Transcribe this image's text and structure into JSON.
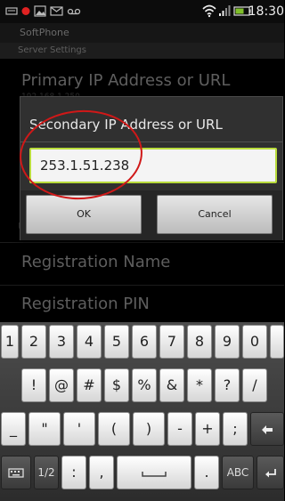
{
  "status": {
    "time": "18:30",
    "icons": [
      "keyboard-notification-icon",
      "red-dot-notification-icon",
      "image-notification-icon",
      "mail-notification-icon",
      "voicemail-notification-icon",
      "wifi-icon",
      "signal-icon",
      "battery-icon"
    ]
  },
  "app": {
    "title": "SoftPhone",
    "section": "Server Settings"
  },
  "settings": {
    "primary_label": "Primary IP Address or URL",
    "primary_value": "192.168.1.250",
    "registration_name": "Registration Name",
    "registration_pin": "Registration PIN",
    "left_char": "U"
  },
  "dialog": {
    "title": "Secondary IP Address or URL",
    "input_value": "253.1.51.238",
    "ok_label": "OK",
    "cancel_label": "Cancel",
    "focus_color": "#b9dc3c"
  },
  "keyboard": {
    "row1": [
      "1",
      "2",
      "3",
      "4",
      "5",
      "6",
      "7",
      "8",
      "9",
      "0"
    ],
    "row2": [
      "!",
      "@",
      "#",
      "$",
      "%",
      "&",
      "*",
      "?",
      "/"
    ],
    "row3": [
      "_",
      "\"",
      "'",
      "(",
      ")",
      "-",
      "+",
      ";"
    ],
    "row4_page": "1/2",
    "row4_colon": ":",
    "row4_comma": ",",
    "row4_period": ".",
    "row4_abc": "ABC"
  },
  "annotation_color": "#d01818"
}
